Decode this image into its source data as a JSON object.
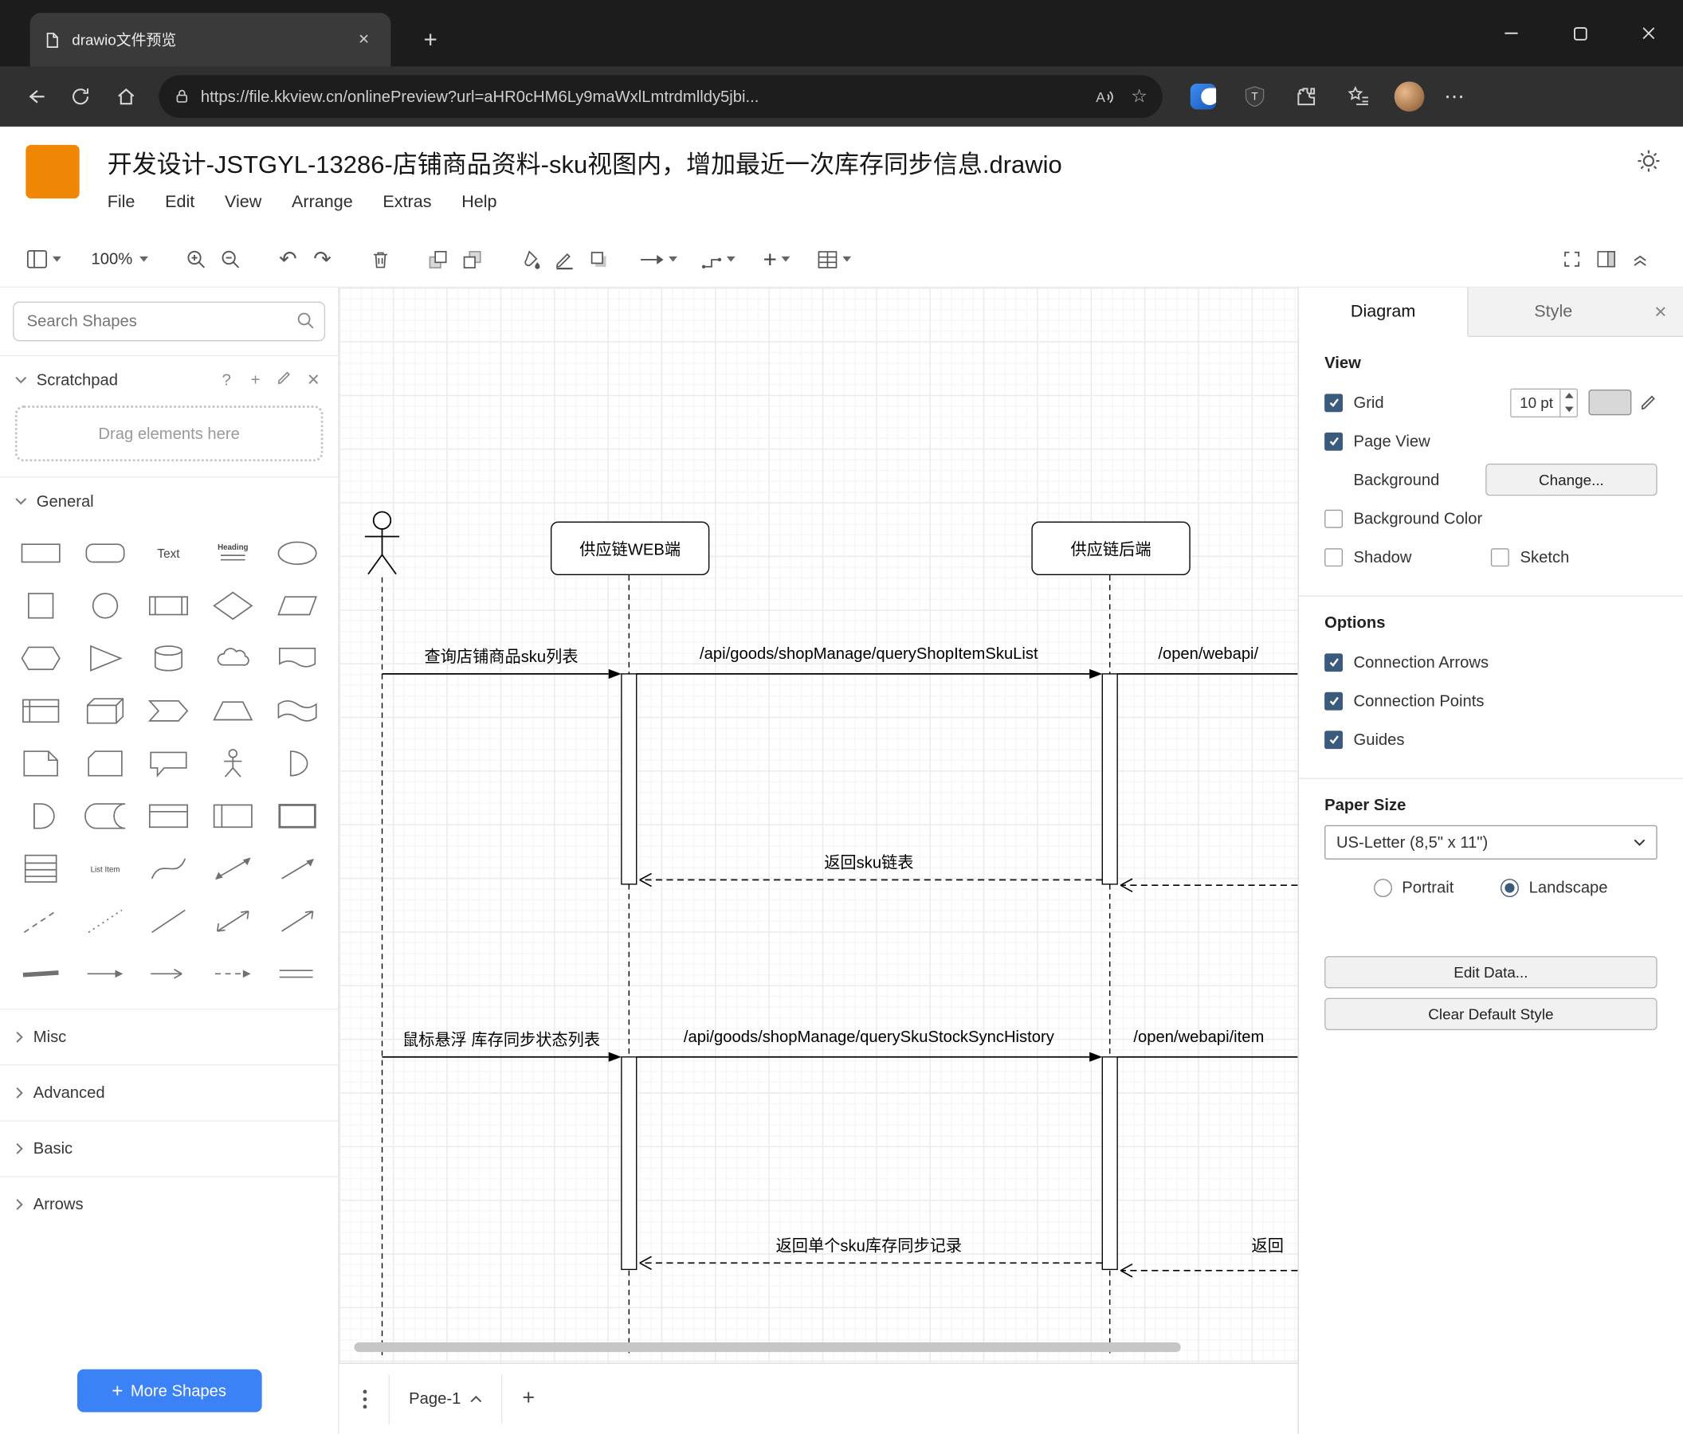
{
  "browser": {
    "tab_title": "drawio文件预览",
    "url": "https://file.kkview.cn/onlinePreview?url=aHR0cHM6Ly9maWxlLmtrdmlldy5jbi..."
  },
  "header": {
    "title": "开发设计-JSTGYL-13286-店铺商品资料-sku视图内，增加最近一次库存同步信息.drawio",
    "menus": [
      "File",
      "Edit",
      "View",
      "Arrange",
      "Extras",
      "Help"
    ]
  },
  "toolbar": {
    "zoom_level": "100%"
  },
  "sidebar": {
    "search_placeholder": "Search Shapes",
    "scratchpad_title": "Scratchpad",
    "scratchpad_hint": "Drag elements here",
    "sections": {
      "general": "General",
      "misc": "Misc",
      "advanced": "Advanced",
      "basic": "Basic",
      "arrows": "Arrows"
    },
    "more_shapes_label": "More Shapes",
    "shapes": [
      "rectangle",
      "rounded-rectangle",
      "text",
      "heading",
      "ellipse",
      "square",
      "circle",
      "process",
      "diamond",
      "parallelogram",
      "hexagon",
      "triangle",
      "cylinder",
      "cloud",
      "document",
      "internal-storage",
      "cube",
      "step",
      "trapezoid",
      "tape",
      "note",
      "card",
      "callout",
      "actor",
      "or",
      "and",
      "data-storage",
      "container",
      "vertical-container",
      "horizontal-container",
      "list",
      "list-item",
      "curve",
      "bidirectional-arrow",
      "arrow",
      "dashed-line",
      "dotted-line",
      "line",
      "bidirectional-connector",
      "directional-connector",
      "link",
      "arrow-h1",
      "arrow-h2",
      "arrow-h3",
      "arrow-h4"
    ]
  },
  "canvas": {
    "lifelines": {
      "web": "供应链WEB端",
      "backend": "供应链后端"
    },
    "messages": {
      "m1": "查询店铺商品sku列表",
      "m2": "/api/goods/shopManage/queryShopItemSkuList",
      "m3": "/open/webapi/",
      "r1": "返回sku链表",
      "m4": "鼠标悬浮 库存同步状态列表",
      "m5": "/api/goods/shopManage/querySkuStockSyncHistory",
      "m6": "/open/webapi/item",
      "r2": "返回单个sku库存同步记录",
      "r3": "返回"
    },
    "page_tab": "Page-1"
  },
  "format": {
    "tabs": {
      "diagram": "Diagram",
      "style": "Style"
    },
    "view": {
      "heading": "View",
      "grid": "Grid",
      "grid_size": "10 pt",
      "page_view": "Page View",
      "background": "Background",
      "change_button": "Change...",
      "background_color": "Background Color",
      "shadow": "Shadow",
      "sketch": "Sketch"
    },
    "options": {
      "heading": "Options",
      "connection_arrows": "Connection Arrows",
      "connection_points": "Connection Points",
      "guides": "Guides"
    },
    "paper": {
      "heading": "Paper Size",
      "size": "US-Letter (8,5\" x 11\")",
      "portrait": "Portrait",
      "landscape": "Landscape"
    },
    "buttons": {
      "edit_data": "Edit Data...",
      "clear_default_style": "Clear Default Style"
    }
  },
  "colors": {
    "logo_orange": "#F08705",
    "more_shapes_blue": "#3b82f6",
    "checkbox_navy": "#3b5b7d"
  }
}
